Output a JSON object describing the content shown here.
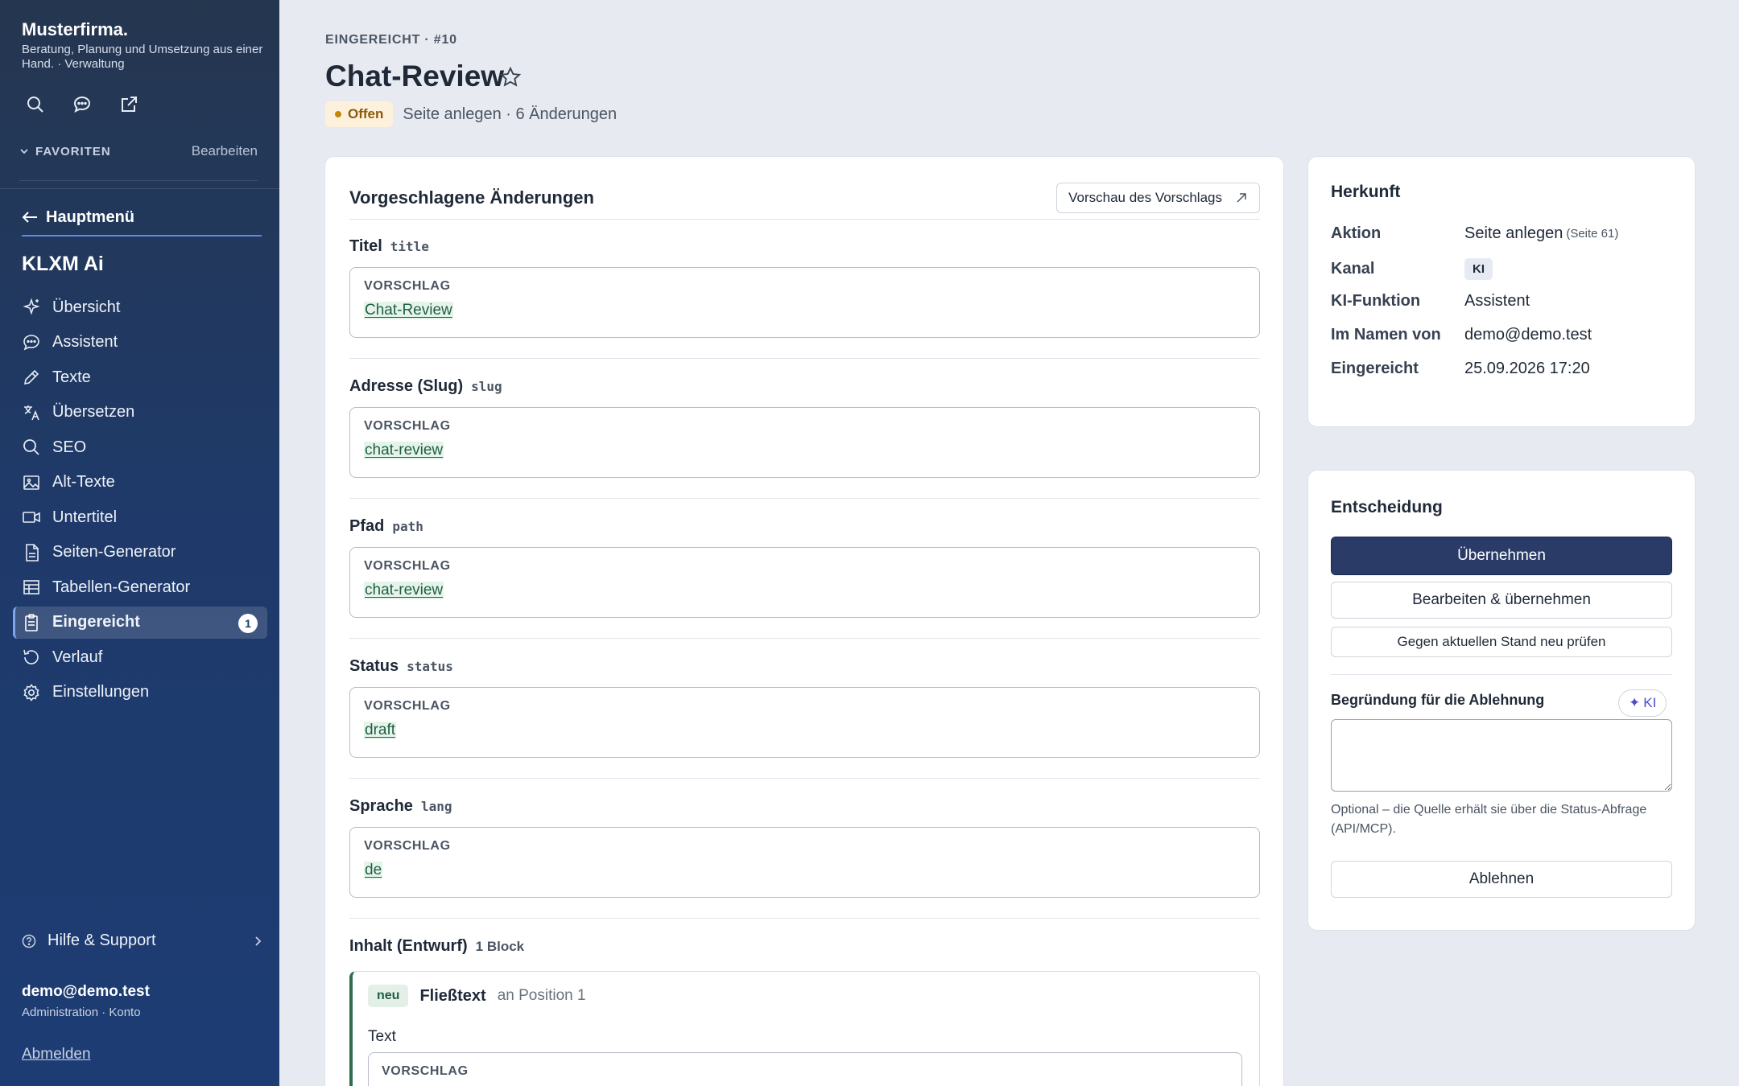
{
  "sidebar": {
    "brand": "Musterfirma.",
    "brand_sub": "Beratung, Planung und Umsetzung aus einer Hand. · Verwaltung",
    "tools": [
      "search-icon",
      "chat-icon",
      "external-link-icon"
    ],
    "favorites_label": "FAVORITEN",
    "favorites_edit": "Bearbeiten",
    "back_label": "Hauptmenü",
    "section_title": "KLXM Ai",
    "items": [
      {
        "label": "Übersicht",
        "icon": "sparkle-icon"
      },
      {
        "label": "Assistent",
        "icon": "chat-icon"
      },
      {
        "label": "Texte",
        "icon": "pencil-icon"
      },
      {
        "label": "Übersetzen",
        "icon": "translate-icon"
      },
      {
        "label": "SEO",
        "icon": "search-icon"
      },
      {
        "label": "Alt-Texte",
        "icon": "image-icon"
      },
      {
        "label": "Untertitel",
        "icon": "video-icon"
      },
      {
        "label": "Seiten-Generator",
        "icon": "document-icon"
      },
      {
        "label": "Tabellen-Generator",
        "icon": "table-icon"
      },
      {
        "label": "Eingereicht",
        "icon": "clipboard-icon",
        "badge": "1",
        "active": true
      },
      {
        "label": "Verlauf",
        "icon": "history-icon"
      },
      {
        "label": "Einstellungen",
        "icon": "gear-icon"
      }
    ],
    "help_label": "Hilfe & Support",
    "user_name": "demo@demo.test",
    "user_sub": "Administration · Konto",
    "logout": "Abmelden"
  },
  "header": {
    "kicker": "EINGEREICHT · #10",
    "title": "Chat-Review",
    "status_badge": "Offen",
    "status_text": "Seite anlegen · 6 Änderungen"
  },
  "changes": {
    "title": "Vorgeschlagene Änderungen",
    "preview_button": "Vorschau des Vorschlags",
    "proposal_label": "VORSCHLAG",
    "fields": [
      {
        "label": "Titel",
        "key": "title",
        "value": "Chat-Review"
      },
      {
        "label": "Adresse (Slug)",
        "key": "slug",
        "value": "chat-review"
      },
      {
        "label": "Pfad",
        "key": "path",
        "value": "chat-review"
      },
      {
        "label": "Status",
        "key": "status",
        "value": "draft"
      },
      {
        "label": "Sprache",
        "key": "lang",
        "value": "de"
      }
    ],
    "content": {
      "label": "Inhalt (Entwurf)",
      "meta": "1 Block",
      "block_tag": "neu",
      "block_type": "Fließtext",
      "block_position": "an Position 1",
      "block_sub": "Text"
    }
  },
  "origin": {
    "title": "Herkunft",
    "rows": [
      {
        "key": "Aktion",
        "value": "Seite anlegen",
        "extra": "(Seite 61)"
      },
      {
        "key": "Kanal",
        "chip": "KI"
      },
      {
        "key": "KI-Funktion",
        "value": "Assistent"
      },
      {
        "key": "Im Namen von",
        "value": "demo@demo.test"
      },
      {
        "key": "Eingereicht",
        "value": "25.09.2026 17:20"
      }
    ]
  },
  "decision": {
    "title": "Entscheidung",
    "accept": "Übernehmen",
    "edit_accept": "Bearbeiten & übernehmen",
    "recheck": "Gegen aktuellen Stand neu prüfen",
    "reason_label": "Begründung für die Ablehnung",
    "ki_button": "KI",
    "reason_value": "",
    "hint": "Optional – die Quelle erhält sie über die Status-Abfrage (API/MCP).",
    "reject": "Ablehnen"
  }
}
